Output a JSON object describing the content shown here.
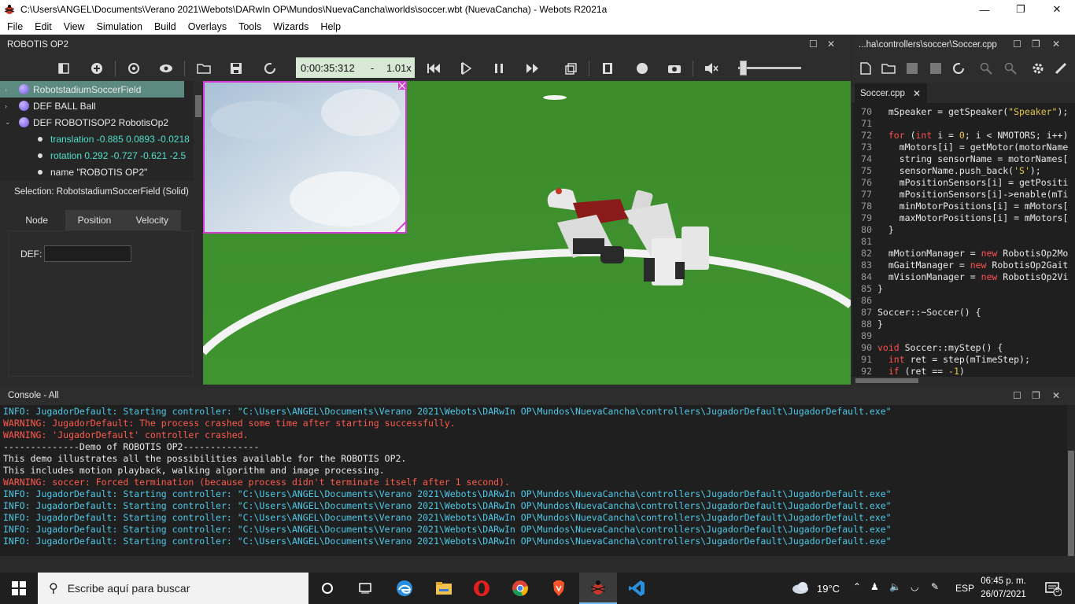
{
  "window": {
    "title": "C:\\Users\\ANGEL\\Documents\\Verano 2021\\Webots\\DARwIn OP\\Mundos\\NuevaCancha\\worlds\\soccer.wbt (NuevaCancha) - Webots R2021a",
    "minimize_icon": "minimize-icon",
    "restore_icon": "restore-icon",
    "close_icon": "close-icon"
  },
  "menu": [
    "File",
    "Edit",
    "View",
    "Simulation",
    "Build",
    "Overlays",
    "Tools",
    "Wizards",
    "Help"
  ],
  "scene_panel": {
    "title": "ROBOTIS OP2",
    "restore_glyph": "☐",
    "close_glyph": "✕"
  },
  "toolbar": {
    "time": "0:00:35:312",
    "separator": "-",
    "speed": "1.01x",
    "icons": [
      "hide-tree-icon",
      "add-node-icon",
      "reload-icon",
      "view-icon",
      "open-world-icon",
      "save-world-icon",
      "reset-simulation-icon",
      "step-back-icon",
      "step-icon",
      "pause-icon",
      "fast-forward-icon",
      "view-3d-icon",
      "record-movie-icon",
      "record-icon",
      "screenshot-icon",
      "mute-icon"
    ],
    "volume": 0.05
  },
  "scene_tree": {
    "nodes": [
      {
        "label": "RobotstadiumSoccerField",
        "arrow": "›",
        "selected": true
      },
      {
        "label": "DEF BALL Ball",
        "arrow": "›",
        "selected": false
      },
      {
        "label": "DEF ROBOTISOP2 RobotisOp2",
        "arrow": "⌄",
        "selected": false
      }
    ],
    "fields": [
      {
        "name": "translation",
        "value": "-0.885 0.0893 -0.0218"
      },
      {
        "name": "rotation",
        "value": "0.292 -0.727 -0.621 -2.5"
      },
      {
        "name": "name",
        "value": "\"ROBOTIS OP2\""
      }
    ]
  },
  "selection_text": "Selection: RobotstadiumSoccerField (Solid)",
  "tabs": [
    "Node",
    "Position",
    "Velocity"
  ],
  "def_label": "DEF:",
  "def_value": "",
  "editor": {
    "title": "...ha\\controllers\\soccer\\Soccer.cpp",
    "tab": "Soccer.cpp",
    "tab_close": "✕",
    "lines": [
      {
        "n": "70",
        "parts": [
          {
            "t": "  mSpeaker = getSpeaker(",
            "c": ""
          },
          {
            "t": "\"Speaker\"",
            "c": "st"
          },
          {
            "t": ");",
            "c": ""
          }
        ]
      },
      {
        "n": "71",
        "parts": [
          {
            "t": "",
            "c": ""
          }
        ]
      },
      {
        "n": "72",
        "parts": [
          {
            "t": "  ",
            "c": ""
          },
          {
            "t": "for",
            "c": "kw"
          },
          {
            "t": " (",
            "c": ""
          },
          {
            "t": "int",
            "c": "kw"
          },
          {
            "t": " i = ",
            "c": ""
          },
          {
            "t": "0",
            "c": "st"
          },
          {
            "t": "; i < NMOTORS; i++)",
            "c": ""
          }
        ]
      },
      {
        "n": "73",
        "parts": [
          {
            "t": "    mMotors[i] = getMotor(motorName",
            "c": ""
          }
        ]
      },
      {
        "n": "74",
        "parts": [
          {
            "t": "    string sensorName = motorNames[",
            "c": ""
          }
        ]
      },
      {
        "n": "75",
        "parts": [
          {
            "t": "    sensorName.push_back(",
            "c": ""
          },
          {
            "t": "'S'",
            "c": "st"
          },
          {
            "t": ");",
            "c": ""
          }
        ]
      },
      {
        "n": "76",
        "parts": [
          {
            "t": "    mPositionSensors[i] = getPositi",
            "c": ""
          }
        ]
      },
      {
        "n": "77",
        "parts": [
          {
            "t": "    mPositionSensors[i]->enable(mTi",
            "c": ""
          }
        ]
      },
      {
        "n": "78",
        "parts": [
          {
            "t": "    minMotorPositions[i] = mMotors[",
            "c": ""
          }
        ]
      },
      {
        "n": "79",
        "parts": [
          {
            "t": "    maxMotorPositions[i] = mMotors[",
            "c": ""
          }
        ]
      },
      {
        "n": "80",
        "parts": [
          {
            "t": "  }",
            "c": ""
          }
        ]
      },
      {
        "n": "81",
        "parts": [
          {
            "t": "",
            "c": ""
          }
        ]
      },
      {
        "n": "82",
        "parts": [
          {
            "t": "  mMotionManager = ",
            "c": ""
          },
          {
            "t": "new",
            "c": "kw"
          },
          {
            "t": " RobotisOp2Mo",
            "c": ""
          }
        ]
      },
      {
        "n": "83",
        "parts": [
          {
            "t": "  mGaitManager = ",
            "c": ""
          },
          {
            "t": "new",
            "c": "kw"
          },
          {
            "t": " RobotisOp2Gait",
            "c": ""
          }
        ]
      },
      {
        "n": "84",
        "parts": [
          {
            "t": "  mVisionManager = ",
            "c": ""
          },
          {
            "t": "new",
            "c": "kw"
          },
          {
            "t": " RobotisOp2Vi",
            "c": ""
          }
        ]
      },
      {
        "n": "85",
        "parts": [
          {
            "t": "}",
            "c": ""
          }
        ]
      },
      {
        "n": "86",
        "parts": [
          {
            "t": "",
            "c": ""
          }
        ]
      },
      {
        "n": "87",
        "parts": [
          {
            "t": "Soccer::~Soccer() {",
            "c": ""
          }
        ]
      },
      {
        "n": "88",
        "parts": [
          {
            "t": "}",
            "c": ""
          }
        ]
      },
      {
        "n": "89",
        "parts": [
          {
            "t": "",
            "c": ""
          }
        ]
      },
      {
        "n": "90",
        "parts": [
          {
            "t": "void",
            "c": "kw"
          },
          {
            "t": " Soccer::myStep() {",
            "c": ""
          }
        ]
      },
      {
        "n": "91",
        "parts": [
          {
            "t": "  ",
            "c": ""
          },
          {
            "t": "int",
            "c": "kw"
          },
          {
            "t": " ret = step(mTimeStep);",
            "c": ""
          }
        ]
      },
      {
        "n": "92",
        "parts": [
          {
            "t": "  ",
            "c": ""
          },
          {
            "t": "if",
            "c": "kw"
          },
          {
            "t": " (ret == ",
            "c": ""
          },
          {
            "t": "-1",
            "c": "st"
          },
          {
            "t": ")",
            "c": ""
          }
        ]
      }
    ]
  },
  "console": {
    "title": "Console - All",
    "lines": [
      {
        "type": "info",
        "text": "INFO: JugadorDefault: Starting controller: \"C:\\Users\\ANGEL\\Documents\\Verano 2021\\Webots\\DARwIn OP\\Mundos\\NuevaCancha\\controllers\\JugadorDefault\\JugadorDefault.exe\""
      },
      {
        "type": "warn",
        "text": "WARNING: JugadorDefault: The process crashed some time after starting successfully."
      },
      {
        "type": "warn",
        "text": "WARNING: 'JugadorDefault' controller crashed."
      },
      {
        "type": "plain",
        "text": "--------------Demo of ROBOTIS OP2--------------"
      },
      {
        "type": "plain",
        "text": "This demo illustrates all the possibilities available for the ROBOTIS OP2."
      },
      {
        "type": "plain",
        "text": "This includes motion playback, walking algorithm and image processing."
      },
      {
        "type": "warn",
        "text": "WARNING: soccer: Forced termination (because process didn't terminate itself after 1 second)."
      },
      {
        "type": "info",
        "text": "INFO: JugadorDefault: Starting controller: \"C:\\Users\\ANGEL\\Documents\\Verano 2021\\Webots\\DARwIn OP\\Mundos\\NuevaCancha\\controllers\\JugadorDefault\\JugadorDefault.exe\""
      },
      {
        "type": "info",
        "text": "INFO: JugadorDefault: Starting controller: \"C:\\Users\\ANGEL\\Documents\\Verano 2021\\Webots\\DARwIn OP\\Mundos\\NuevaCancha\\controllers\\JugadorDefault\\JugadorDefault.exe\""
      },
      {
        "type": "info",
        "text": "INFO: JugadorDefault: Starting controller: \"C:\\Users\\ANGEL\\Documents\\Verano 2021\\Webots\\DARwIn OP\\Mundos\\NuevaCancha\\controllers\\JugadorDefault\\JugadorDefault.exe\""
      },
      {
        "type": "info",
        "text": "INFO: JugadorDefault: Starting controller: \"C:\\Users\\ANGEL\\Documents\\Verano 2021\\Webots\\DARwIn OP\\Mundos\\NuevaCancha\\controllers\\JugadorDefault\\JugadorDefault.exe\""
      },
      {
        "type": "info",
        "text": "INFO: JugadorDefault: Starting controller: \"C:\\Users\\ANGEL\\Documents\\Verano 2021\\Webots\\DARwIn OP\\Mundos\\NuevaCancha\\controllers\\JugadorDefault\\JugadorDefault.exe\""
      }
    ]
  },
  "taskbar": {
    "search_placeholder": "Escribe aquí para buscar",
    "apps": [
      "cortana-icon",
      "task-view-icon",
      "edge-icon",
      "file-explorer-icon",
      "opera-icon",
      "chrome-icon",
      "brave-icon",
      "webots-icon",
      "vscode-icon"
    ],
    "active_app": "webots-icon",
    "temperature": "19°C",
    "language": "ESP",
    "time": "06:45 p. m.",
    "date": "26/07/2021",
    "notifications": "5"
  },
  "colors": {
    "accent_selected": "#5c8a80",
    "field_green": "#3f8f2a",
    "info": "#4ec9e8",
    "warning": "#ff5a4e",
    "time_box": "#d7e9d4"
  }
}
